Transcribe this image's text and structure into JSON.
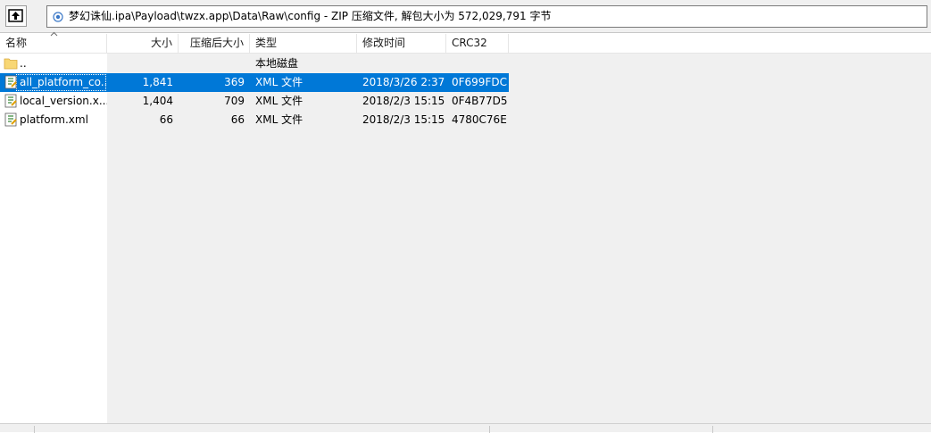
{
  "address": {
    "path": "梦幻诛仙.ipa\\Payload\\twzx.app\\Data\\Raw\\config - ZIP 压缩文件, 解包大小为 572,029,791 字节"
  },
  "columns": {
    "name": "名称",
    "size": "大小",
    "packed": "压缩后大小",
    "type": "类型",
    "modified": "修改时间",
    "crc": "CRC32"
  },
  "rows": [
    {
      "name": "..",
      "size": "",
      "packed": "",
      "type": "本地磁盘",
      "modified": "",
      "crc": ""
    },
    {
      "name": "all_platform_co...",
      "size": "1,841",
      "packed": "369",
      "type": "XML 文件",
      "modified": "2018/3/26 2:37",
      "crc": "0F699FDC"
    },
    {
      "name": "local_version.x...",
      "size": "1,404",
      "packed": "709",
      "type": "XML 文件",
      "modified": "2018/2/3 15:15",
      "crc": "0F4B77D5"
    },
    {
      "name": "platform.xml",
      "size": "66",
      "packed": "66",
      "type": "XML 文件",
      "modified": "2018/2/3 15:15",
      "crc": "4780C76E"
    }
  ],
  "colors": {
    "selection": "#0078d7",
    "folder": "#f8d775",
    "background": "#f0f0f0"
  },
  "icons": {
    "up": "up-folder-icon",
    "archive": "zip-archive-icon",
    "folder": "folder-icon",
    "xml": "xml-file-icon"
  }
}
